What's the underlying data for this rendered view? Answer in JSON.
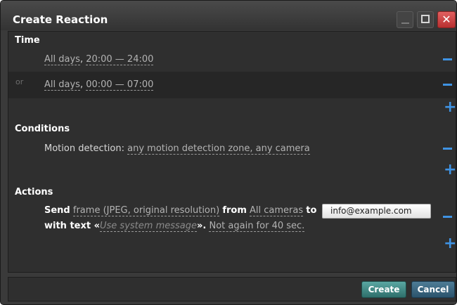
{
  "window": {
    "title": "Create Reaction"
  },
  "sections": {
    "time": {
      "title": "Time",
      "rows": [
        {
          "or": "",
          "days": "All days",
          "sep": ", ",
          "range": "20:00 — 24:00"
        },
        {
          "or": "or",
          "days": "All days",
          "sep": ", ",
          "range": "00:00 — 07:00"
        }
      ]
    },
    "conditions": {
      "title": "Conditions",
      "prefix": "Motion detection: ",
      "target": "any motion detection zone, any camera"
    },
    "actions": {
      "title": "Actions",
      "send": "Send",
      "frame": "frame (JPEG, original resolution)",
      "from": "from",
      "cameras": "All cameras",
      "to": "to",
      "email": "info@example.com",
      "with_text": "with text «",
      "message": "Use system message",
      "close_quote": "».",
      "not_again": "Not again for 40 sec."
    }
  },
  "footer": {
    "create": "Create",
    "cancel": "Cancel"
  },
  "colors": {
    "accent": "#3f93e3",
    "create": "#3f8884",
    "cancel": "#3a6682"
  }
}
